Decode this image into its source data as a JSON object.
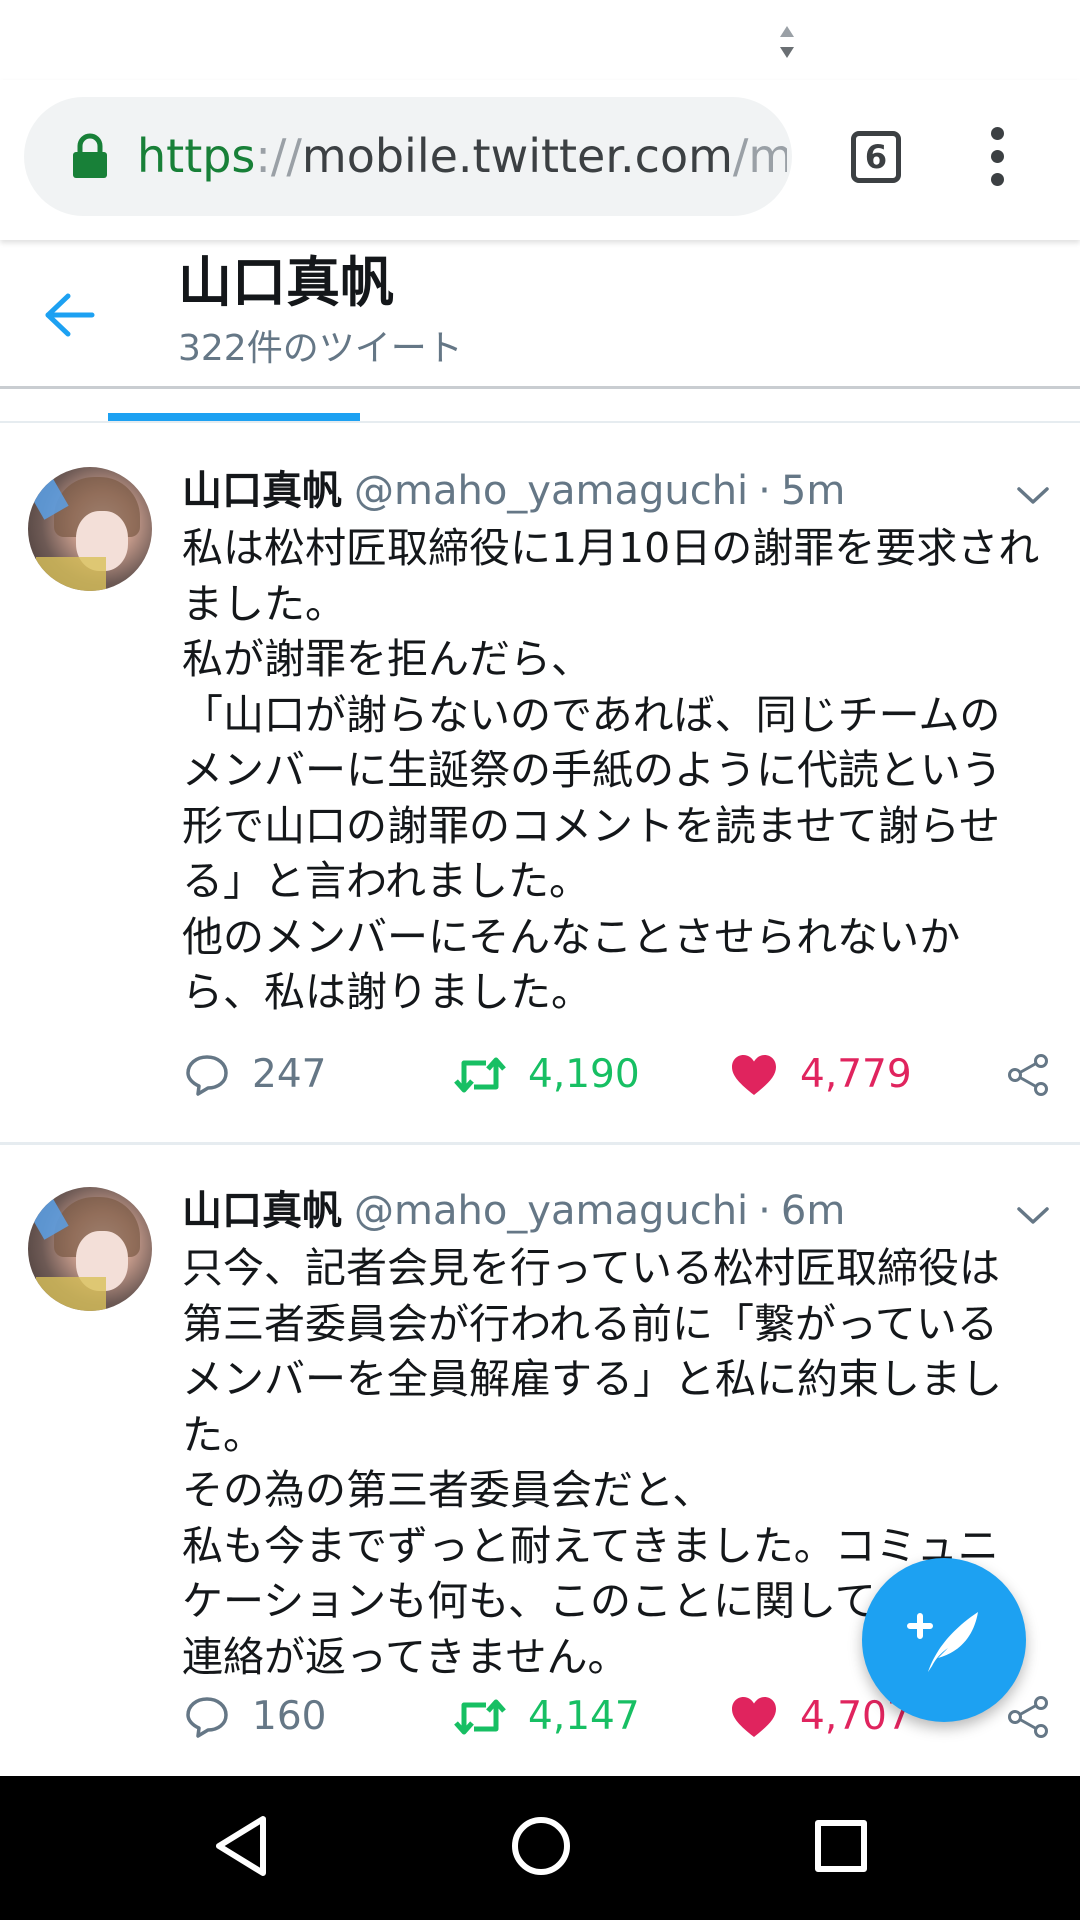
{
  "browser": {
    "url_scheme": "https",
    "url_sep": "://",
    "url_host": "mobile.twitter.com",
    "url_tail": "/ma",
    "tab_count": "6"
  },
  "header": {
    "title": "山口真帆",
    "subtitle": "322件のツイート"
  },
  "tweets": [
    {
      "name": "山口真帆",
      "handle": "@maho_yamaguchi",
      "dot": "·",
      "time": "5m",
      "lines": [
        "私は松村匠取締役に1月10日の謝罪を要求され",
        "ました。",
        "私が謝罪を拒んだら、",
        "「山口が謝らないのであれば、同じチームの",
        "メンバーに生誕祭の手紙のように代読という",
        "形で山口の謝罪のコメントを読ませて謝らせ",
        "る」と言われました。",
        "他のメンバーにそんなことさせられないか",
        "ら、私は謝りました。"
      ],
      "replies": "247",
      "retweets": "4,190",
      "likes": "4,779"
    },
    {
      "name": "山口真帆",
      "handle": "@maho_yamaguchi",
      "dot": "·",
      "time": "6m",
      "lines": [
        "只今、記者会見を行っている松村匠取締役は",
        "第三者委員会が行われる前に「繋がっている",
        "メンバーを全員解雇する」と私に約束しまし",
        "た。",
        "その為の第三者委員会だと、",
        "私も今までずっと耐えてきました。コミュニ",
        "ケーションも何も、このことに関して",
        "連絡が返ってきません。"
      ],
      "replies": "160",
      "retweets": "4,147",
      "likes": "4,707"
    }
  ],
  "icons": {
    "lock": "lock-icon",
    "back": "back-arrow-icon",
    "caret": "chevron-down-icon",
    "reply": "reply-icon",
    "retweet": "retweet-icon",
    "like": "heart-icon",
    "share": "share-icon",
    "compose": "compose-tweet-icon"
  },
  "colors": {
    "accent": "#1da1f2",
    "secure": "#188038",
    "retweet": "#17bf63",
    "like": "#e0245e",
    "muted": "#657786"
  }
}
